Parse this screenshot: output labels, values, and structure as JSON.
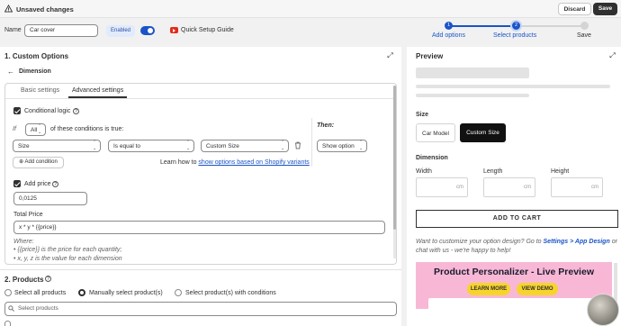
{
  "topbar": {
    "title": "Unsaved changes",
    "discard": "Discard",
    "save": "Save"
  },
  "namebar": {
    "label": "Name",
    "value": "Car cover",
    "status": "Enabled",
    "quick_setup": "Quick Setup Guide"
  },
  "steps": [
    {
      "num": "1",
      "label": "Add options",
      "state": "done"
    },
    {
      "num": "2",
      "label": "Select products",
      "state": "current"
    },
    {
      "num": "3",
      "label": "Save",
      "state": "todo"
    }
  ],
  "custom_options": {
    "heading": "1. Custom Options",
    "back_label": "Dimension",
    "tabs": [
      "Basic settings",
      "Advanced settings"
    ],
    "conditional_logic": "Conditional logic",
    "if_label": "If",
    "match_value": "All",
    "match_suffix": "of these conditions is true:",
    "then_label": "Then:",
    "condition": {
      "field": "Size",
      "operator": "Is equal to",
      "value": "Custom Size"
    },
    "then_value": "Show option",
    "add_condition": "Add condition",
    "learn_prefix": "Learn how to ",
    "learn_link": "show options based on Shopify variants",
    "add_price": "Add price",
    "price_value": "0,0125",
    "total_price_label": "Total Price",
    "total_price_value": "x * y * {{price}}",
    "where_label": "Where:",
    "notes": [
      "{{price}} is the price for each quantity;",
      "x, y, z is the value for each dimension"
    ]
  },
  "products": {
    "heading": "2. Products",
    "radios": [
      "Select all products",
      "Manually select product(s)",
      "Select product(s) with conditions"
    ],
    "selected_index": 1,
    "search_placeholder": "Select products"
  },
  "preview": {
    "heading": "Preview",
    "size_label": "Size",
    "size_options": [
      "Car Model",
      "Custom Size"
    ],
    "size_selected": "Custom Size",
    "dimension_label": "Dimension",
    "dims": [
      {
        "label": "Width",
        "unit": "cm"
      },
      {
        "label": "Length",
        "unit": "cm"
      },
      {
        "label": "Height",
        "unit": "cm"
      }
    ],
    "add_to_cart": "ADD TO CART",
    "customize_prefix": "Want to customize your option design? Go to ",
    "customize_link": "Settings > App Design",
    "customize_suffix": " or chat with us - we're happy to help!",
    "banner_title": "Product Personalizer - Live Preview",
    "banner_learn": "LEARN MORE",
    "banner_demo": "VIEW DEMO"
  },
  "colors": {
    "accent": "#1a54c8",
    "dark": "#303030",
    "banner": "#f8b8d5",
    "banner_button": "#f6d42c"
  }
}
